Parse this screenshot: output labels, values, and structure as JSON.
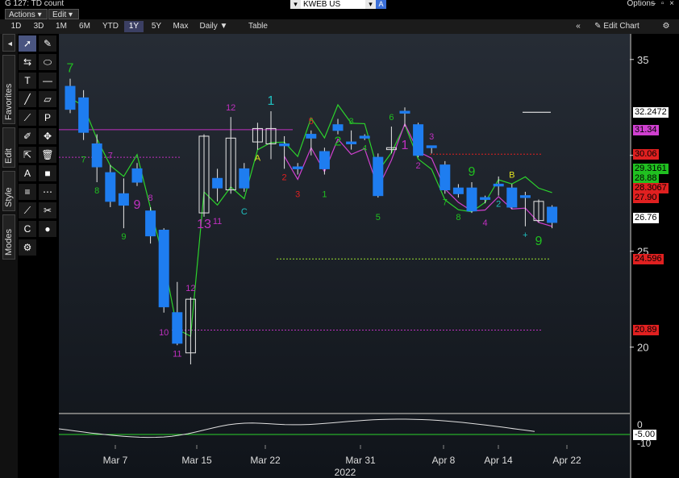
{
  "window": {
    "title": "G 127: TD count",
    "security": "KWEB US Equity",
    "options_label": "Options",
    "window_controls": "– ▫ ×"
  },
  "menu": {
    "actions": "Actions ▾",
    "edit": "Edit ▾"
  },
  "toolbar": {
    "periods": [
      "1D",
      "3D",
      "1M",
      "6M",
      "YTD",
      "1Y",
      "5Y",
      "Max"
    ],
    "selected_period": "1Y",
    "frequency": "Daily ▼",
    "table": "Table",
    "edit_chart": "Edit Chart",
    "nav": "«"
  },
  "side_tabs": [
    "Favorites",
    "Edit",
    "Style",
    "Modes"
  ],
  "tools": [
    "pointer-icon",
    "pencil-icon",
    "fib-icon",
    "ellipse-icon",
    "text-icon",
    "line-icon",
    "trendline-icon",
    "channel-icon",
    "trend-icon",
    "p-icon",
    "brush-icon",
    "crosshair-icon",
    "cursor-icon",
    "trash-icon",
    "a-icon",
    "square-icon",
    "lines-icon",
    "dashed-lines-icon",
    "ruler-icon",
    "scissor-icon",
    "c-icon",
    "color-icon",
    "settings-icon"
  ],
  "chart_data": {
    "type": "candlestick",
    "x_labels": [
      "Mar 7",
      "Mar 15",
      "Mar 22",
      "Mar 31",
      "Apr 8",
      "Apr 14",
      "Apr 22"
    ],
    "year_label": "2022",
    "y_ticks": [
      35,
      30,
      25,
      20
    ],
    "ylim": [
      17,
      36
    ],
    "price_labels": [
      {
        "value": "32.2472",
        "bg": "#ffffff",
        "fg": "#000000"
      },
      {
        "value": "31.34",
        "bg": "#d040d0",
        "fg": "#000000"
      },
      {
        "value": "30.06",
        "bg": "#e02020",
        "fg": "#000000"
      },
      {
        "value": "29.3161",
        "bg": "#20c020",
        "fg": "#000000"
      },
      {
        "value": "28.88",
        "bg": "#20c020",
        "fg": "#000000"
      },
      {
        "value": "28.3067",
        "bg": "#e02020",
        "fg": "#000000"
      },
      {
        "value": "27.90",
        "bg": "#e02020",
        "fg": "#000000"
      },
      {
        "value": "26.76",
        "bg": "#ffffff",
        "fg": "#000000"
      },
      {
        "value": "24.596",
        "bg": "#e02020",
        "fg": "#000000"
      },
      {
        "value": "20.89",
        "bg": "#e02020",
        "fg": "#000000"
      }
    ],
    "candles": [
      {
        "o": 33.6,
        "h": 34.0,
        "c": 32.4,
        "l": 32.2
      },
      {
        "o": 33.0,
        "h": 33.4,
        "c": 31.2,
        "l": 30.8
      },
      {
        "o": 30.6,
        "h": 31.1,
        "c": 29.4,
        "l": 28.6
      },
      {
        "o": 29.1,
        "h": 29.5,
        "c": 27.6,
        "l": 27.3
      },
      {
        "o": 28.0,
        "h": 28.8,
        "c": 27.4,
        "l": 26.2
      },
      {
        "o": 29.3,
        "h": 29.6,
        "c": 28.6,
        "l": 28.4
      },
      {
        "o": 27.1,
        "h": 27.3,
        "c": 25.8,
        "l": 25.4
      },
      {
        "o": 26.1,
        "h": 26.2,
        "c": 22.1,
        "l": 21.8
      },
      {
        "o": 21.8,
        "h": 23.4,
        "c": 20.2,
        "l": 20.1
      },
      {
        "o": 19.7,
        "h": 22.6,
        "c": 22.5,
        "l": 19.1
      },
      {
        "o": 27.0,
        "h": 31.1,
        "c": 31.0,
        "l": 26.8
      },
      {
        "o": 28.8,
        "h": 29.3,
        "c": 28.3,
        "l": 27.6
      },
      {
        "o": 28.2,
        "h": 32.0,
        "c": 30.9,
        "l": 28.0
      },
      {
        "o": 29.3,
        "h": 29.6,
        "c": 28.3,
        "l": 28.1
      },
      {
        "o": 30.7,
        "h": 31.7,
        "c": 31.4,
        "l": 30.3
      },
      {
        "o": 30.6,
        "h": 32.3,
        "c": 31.4,
        "l": 29.8
      },
      {
        "o": 30.6,
        "h": 31.0,
        "c": 30.5,
        "l": 29.3
      },
      {
        "o": 29.4,
        "h": 29.6,
        "c": 29.3,
        "l": 29.0
      },
      {
        "o": 31.1,
        "h": 31.3,
        "c": 30.9,
        "l": 30.0
      },
      {
        "o": 30.2,
        "h": 30.4,
        "c": 29.3,
        "l": 29.0
      },
      {
        "o": 31.6,
        "h": 31.9,
        "c": 31.3,
        "l": 31.1
      },
      {
        "o": 30.7,
        "h": 31.3,
        "c": 30.6,
        "l": 30.3
      },
      {
        "o": 31.0,
        "h": 31.1,
        "c": 30.9,
        "l": 30.8
      },
      {
        "o": 29.9,
        "h": 30.1,
        "c": 27.9,
        "l": 27.8
      },
      {
        "o": 30.3,
        "h": 31.5,
        "c": 30.4,
        "l": 30.1
      },
      {
        "o": 32.3,
        "h": 32.5,
        "c": 32.2,
        "l": 31.5
      },
      {
        "o": 31.6,
        "h": 31.7,
        "c": 30.0,
        "l": 29.9
      },
      {
        "o": 30.5,
        "h": 30.5,
        "c": 30.4,
        "l": 30.1
      },
      {
        "o": 29.5,
        "h": 29.7,
        "c": 28.2,
        "l": 28.0
      },
      {
        "o": 28.3,
        "h": 28.5,
        "c": 28.0,
        "l": 27.8
      },
      {
        "o": 28.3,
        "h": 28.6,
        "c": 27.1,
        "l": 27.0
      },
      {
        "o": 27.8,
        "h": 27.9,
        "c": 27.7,
        "l": 27.5
      },
      {
        "o": 28.5,
        "h": 28.9,
        "c": 28.4,
        "l": 27.9
      },
      {
        "o": 28.3,
        "h": 28.5,
        "c": 27.3,
        "l": 27.2
      },
      {
        "o": 27.9,
        "h": 28.1,
        "c": 27.8,
        "l": 26.3
      },
      {
        "o": 26.6,
        "h": 27.7,
        "c": 27.6,
        "l": 26.5
      },
      {
        "o": 27.3,
        "h": 27.4,
        "c": 26.5,
        "l": 26.2
      }
    ],
    "td_annotations": [
      {
        "text": "7",
        "color": "#20c020"
      },
      {
        "text": "7",
        "color": "#20c020"
      },
      {
        "text": "8",
        "color": "#20c020"
      },
      {
        "text": "7",
        "color": "#c030c0"
      },
      {
        "text": "9",
        "color": "#20c020"
      },
      {
        "text": "9",
        "color": "#c030c0"
      },
      {
        "text": "8",
        "color": "#c030c0"
      },
      {
        "text": "10",
        "color": "#c030c0"
      },
      {
        "text": "11",
        "color": "#c030c0"
      },
      {
        "text": "12",
        "color": "#c030c0"
      },
      {
        "text": "13",
        "color": "#c030c0"
      },
      {
        "text": "11",
        "color": "#c030c0"
      },
      {
        "text": "12",
        "color": "#c030c0"
      },
      {
        "text": "C",
        "color": "#20c0c0"
      },
      {
        "text": "A",
        "color": "#e0e020"
      },
      {
        "text": "1",
        "color": "#20c0c0"
      },
      {
        "text": "2",
        "color": "#e02020"
      },
      {
        "text": "3",
        "color": "#e02020"
      },
      {
        "text": "5",
        "color": "#e02020"
      },
      {
        "text": "1",
        "color": "#20c020"
      },
      {
        "text": "2",
        "color": "#20c020"
      },
      {
        "text": "3",
        "color": "#20c020"
      },
      {
        "text": "4",
        "color": "#20c020"
      },
      {
        "text": "5",
        "color": "#20c020"
      },
      {
        "text": "6",
        "color": "#20c020"
      },
      {
        "text": "1",
        "color": "#c030c0"
      },
      {
        "text": "2",
        "color": "#c030c0"
      },
      {
        "text": "3",
        "color": "#c030c0"
      },
      {
        "text": "7",
        "color": "#20c020"
      },
      {
        "text": "8",
        "color": "#20c020"
      },
      {
        "text": "9",
        "color": "#20c020"
      },
      {
        "text": "4",
        "color": "#c030c0"
      },
      {
        "text": "2",
        "color": "#20c0c0"
      },
      {
        "text": "B",
        "color": "#e0e020"
      },
      {
        "text": "+",
        "color": "#20c0c0"
      },
      {
        "text": "9",
        "color": "#20c020"
      }
    ],
    "indicator": {
      "label": "-5.00",
      "y_ticks": [
        0,
        -10
      ]
    }
  }
}
